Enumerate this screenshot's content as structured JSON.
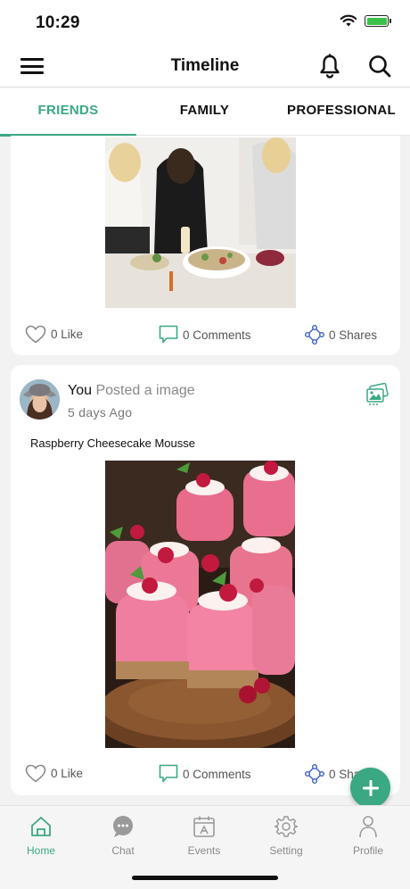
{
  "status_bar": {
    "time": "10:29"
  },
  "header": {
    "title": "Timeline"
  },
  "tabs": [
    {
      "label": "FRIENDS",
      "active": true
    },
    {
      "label": "FAMILY",
      "active": false
    },
    {
      "label": "PROFESSIONAL",
      "active": false
    }
  ],
  "posts": [
    {
      "image_description": "friends-cooking-photo",
      "likes": "0 Like",
      "comments": "0 Comments",
      "shares": "0 Shares"
    },
    {
      "author": "You",
      "action": "Posted a image",
      "time": "5 days Ago",
      "caption": "Raspberry Cheesecake Mousse",
      "image_description": "raspberry-mousse-photo",
      "likes": "0 Like",
      "comments": "0 Comments",
      "shares": "0 Shares"
    }
  ],
  "bottom_nav": [
    {
      "label": "Home",
      "icon": "home-icon",
      "active": true
    },
    {
      "label": "Chat",
      "icon": "chat-icon",
      "active": false
    },
    {
      "label": "Events",
      "icon": "events-icon",
      "active": false
    },
    {
      "label": "Setting",
      "icon": "gear-icon",
      "active": false
    },
    {
      "label": "Profile",
      "icon": "profile-icon",
      "active": false
    }
  ],
  "colors": {
    "accent": "#3aa883",
    "like": "#888888",
    "comment": "#3aa883",
    "share": "#3b5fc4"
  }
}
